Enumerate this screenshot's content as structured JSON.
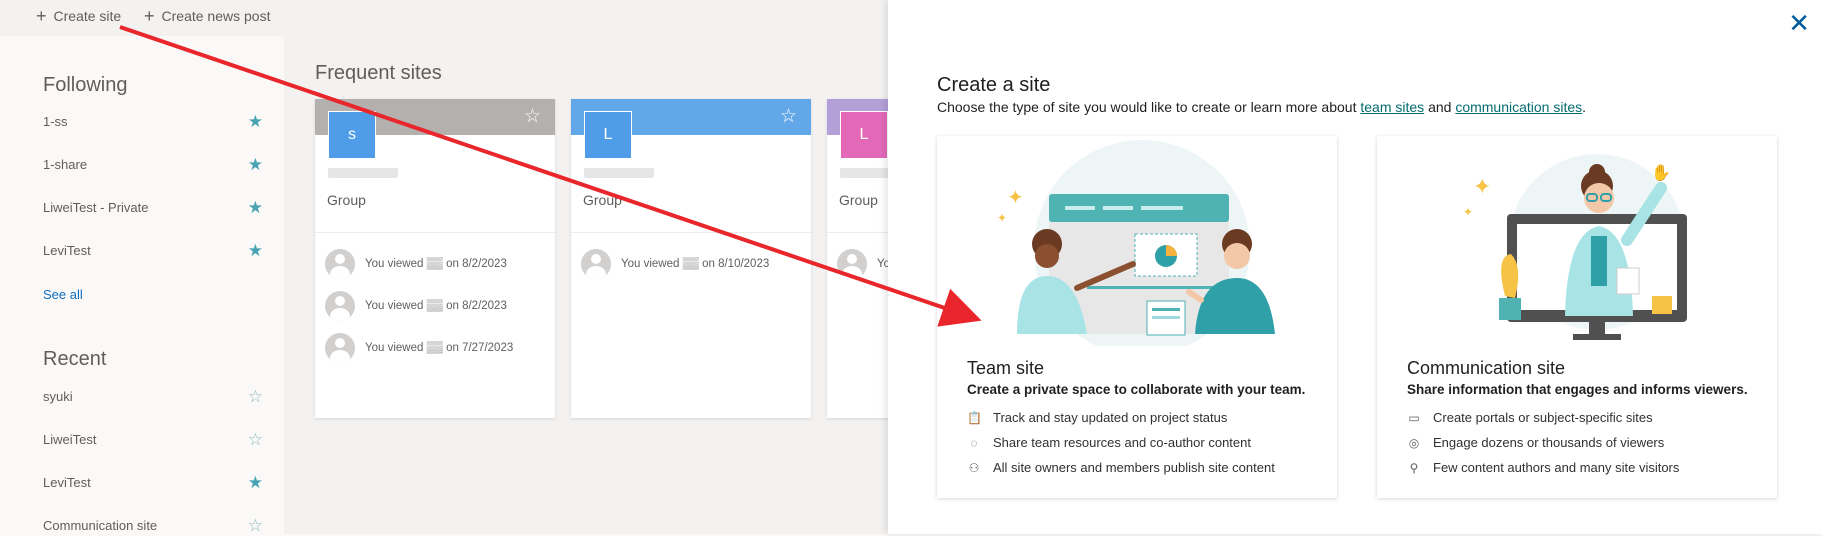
{
  "topbar": {
    "create_site": "Create site",
    "create_news": "Create news post"
  },
  "sidebar": {
    "following_title": "Following",
    "following": [
      {
        "label": "1-ss",
        "starred": true
      },
      {
        "label": "1-share",
        "starred": true
      },
      {
        "label": "LiweiTest - Private",
        "starred": true
      },
      {
        "label": "LeviTest",
        "starred": true
      }
    ],
    "see_all": "See all",
    "recent_title": "Recent",
    "recent": [
      {
        "label": "syuki",
        "starred": false
      },
      {
        "label": "LiweiTest",
        "starred": false
      },
      {
        "label": "LeviTest",
        "starred": true
      },
      {
        "label": "Communication site",
        "starred": false
      }
    ]
  },
  "main": {
    "frequent_title": "Frequent sites",
    "cards": [
      {
        "initial": "s",
        "type": "Group",
        "band_color": "#b3b0ad",
        "tile_color": "#4f9de8",
        "activity": [
          {
            "text": "You viewed",
            "date": "on 8/2/2023"
          },
          {
            "text": "You viewed",
            "date": "on 8/2/2023"
          },
          {
            "text": "You viewed",
            "date": "on 7/27/2023"
          }
        ]
      },
      {
        "initial": "L",
        "type": "Group",
        "band_color": "#62a8e8",
        "tile_color": "#4f9de8",
        "activity": [
          {
            "text": "You viewed",
            "date": "on 8/10/2023"
          }
        ]
      },
      {
        "initial": "L",
        "type": "Group",
        "band_color": "#b4a0d8",
        "tile_color": "#e369b8",
        "activity": [
          {
            "text": "Yo",
            "date": ""
          }
        ]
      }
    ]
  },
  "panel": {
    "title": "Create a site",
    "subtitle_pre": "Choose the type of site you would like to create or learn more about",
    "link_team": "team sites",
    "subtitle_and": "and",
    "link_comm": "communication sites",
    "subtitle_end": ".",
    "team": {
      "name": "Team site",
      "desc": "Create a private space to collaborate with your team.",
      "features": [
        {
          "icon": "clipboard-icon",
          "text": "Track and stay updated on project status"
        },
        {
          "icon": "sync-icon",
          "text": "Share team resources and co-author content"
        },
        {
          "icon": "people-icon",
          "text": "All site owners and members publish site content"
        }
      ]
    },
    "communication": {
      "name": "Communication site",
      "desc": "Share information that engages and informs viewers.",
      "features": [
        {
          "icon": "page-icon",
          "text": "Create portals or subject-specific sites"
        },
        {
          "icon": "broadcast-icon",
          "text": "Engage dozens or thousands of viewers"
        },
        {
          "icon": "person-icon",
          "text": "Few content authors and many site visitors"
        }
      ]
    }
  },
  "colors": {
    "accent": "#036c70",
    "arrow": "#e8262b",
    "star": "#4aa3b2"
  }
}
